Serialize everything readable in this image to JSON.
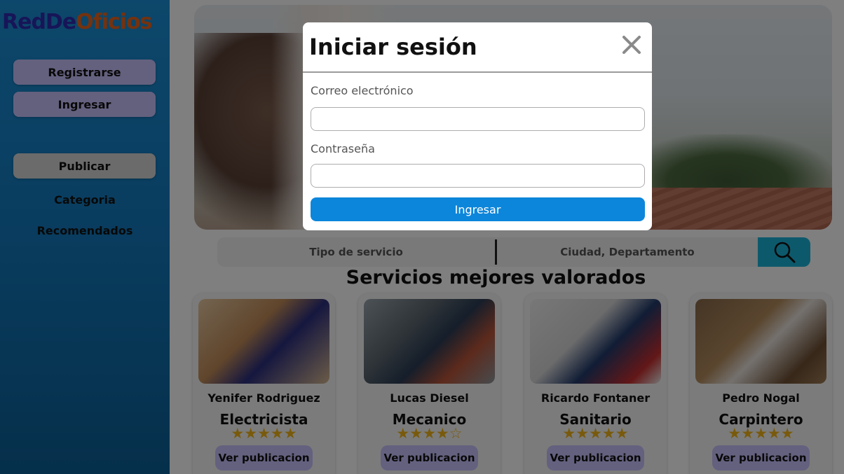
{
  "logo": {
    "part1": "RedDe",
    "part2": "Oficios"
  },
  "sidebar": {
    "register_label": "Registrarse",
    "login_label": "Ingresar",
    "publish_label": "Publicar",
    "category_label": "Categoria",
    "recommended_label": "Recomendados"
  },
  "search": {
    "service_type": "Tipo de servicio",
    "location": "Ciudad, Departamento",
    "icon": "search-icon"
  },
  "section_title": "Servicios mejores valorados",
  "cards": [
    {
      "name": "Yenifer Rodriguez",
      "trade": "Electricista",
      "rating": 5,
      "stars": "★★★★★",
      "button": "Ver publicacion"
    },
    {
      "name": "Lucas Diesel",
      "trade": "Mecanico",
      "rating": 4,
      "stars": "★★★★",
      "stars_empty": "☆",
      "button": "Ver publicacion"
    },
    {
      "name": "Ricardo Fontaner",
      "trade": "Sanitario",
      "rating": 5,
      "stars": "★★★★★",
      "button": "Ver publicacion"
    },
    {
      "name": "Pedro Nogal",
      "trade": "Carpintero",
      "rating": 5,
      "stars": "★★★★★",
      "button": "Ver publicacion"
    }
  ],
  "modal": {
    "title": "Iniciar sesión",
    "close_icon": "close-icon",
    "email_label": "Correo electrónico",
    "email_value": "",
    "password_label": "Contraseña",
    "password_value": "",
    "submit_label": "Ingresar"
  },
  "colors": {
    "sidebar_top": "#1a8fd6",
    "sidebar_bottom": "#0b5f96",
    "logo_blue": "#2f2bb0",
    "logo_orange": "#e8651c",
    "button_purple": "#c9c3ff",
    "star": "#f2b418",
    "search_button": "#1ab2d8",
    "submit_button": "#0c86db"
  }
}
